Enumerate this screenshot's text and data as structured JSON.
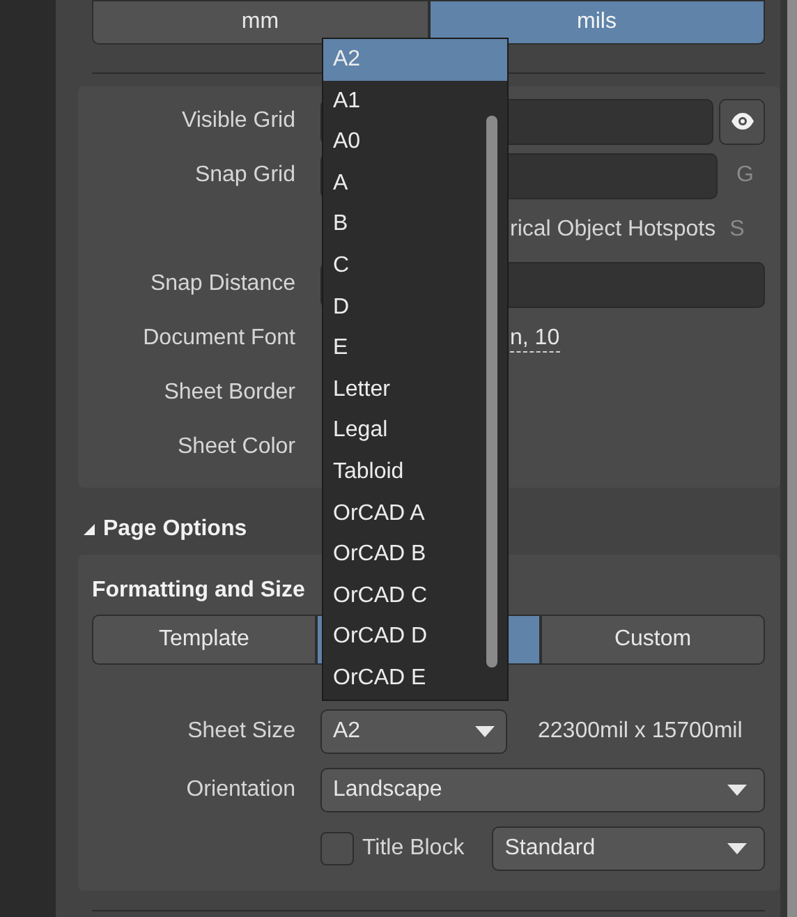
{
  "units_toggle": [
    {
      "label": "mm",
      "selected": false
    },
    {
      "label": "mils",
      "selected": true
    }
  ],
  "grid_settings": {
    "rows": [
      {
        "kind": "field_button",
        "label": "Visible Grid"
      },
      {
        "kind": "field_hint",
        "label": "Snap Grid",
        "hint": "G"
      },
      {
        "kind": "checkbox_text",
        "text": "rical Object Hotspots",
        "hint": "S"
      },
      {
        "kind": "field",
        "label": "Snap Distance"
      },
      {
        "kind": "link",
        "label": "Document Font",
        "value": "n, 10"
      },
      {
        "kind": "label",
        "label": "Sheet Border"
      },
      {
        "kind": "label",
        "label": "Sheet Color"
      }
    ]
  },
  "page_options": {
    "title": "Page Options",
    "expanded": true,
    "formatting": {
      "title": "Formatting and Size",
      "modes": [
        {
          "label": "Template",
          "selected": false
        },
        {
          "selected": true
        },
        {
          "label": "Custom",
          "selected": false
        }
      ],
      "sheet_size": {
        "label": "Sheet Size",
        "value": "A2",
        "dimensions": "22300mil  x  15700mil"
      },
      "orientation": {
        "label": "Orientation",
        "value": "Landscape"
      },
      "title_block": {
        "label": "Title Block",
        "checked": false,
        "value": "Standard"
      }
    }
  },
  "dropdown_list": {
    "items": [
      {
        "label": "A2",
        "selected": true
      },
      {
        "label": "A1",
        "selected": false
      },
      {
        "label": "A0",
        "selected": false
      },
      {
        "label": "A",
        "selected": false
      },
      {
        "label": "B",
        "selected": false
      },
      {
        "label": "C",
        "selected": false
      },
      {
        "label": "D",
        "selected": false
      },
      {
        "label": "E",
        "selected": false
      },
      {
        "label": "Letter",
        "selected": false
      },
      {
        "label": "Legal",
        "selected": false
      },
      {
        "label": "Tabloid",
        "selected": false
      },
      {
        "label": "OrCAD A",
        "selected": false
      },
      {
        "label": "OrCAD B",
        "selected": false
      },
      {
        "label": "OrCAD C",
        "selected": false
      },
      {
        "label": "OrCAD D",
        "selected": false
      },
      {
        "label": "OrCAD E",
        "selected": false
      }
    ]
  }
}
